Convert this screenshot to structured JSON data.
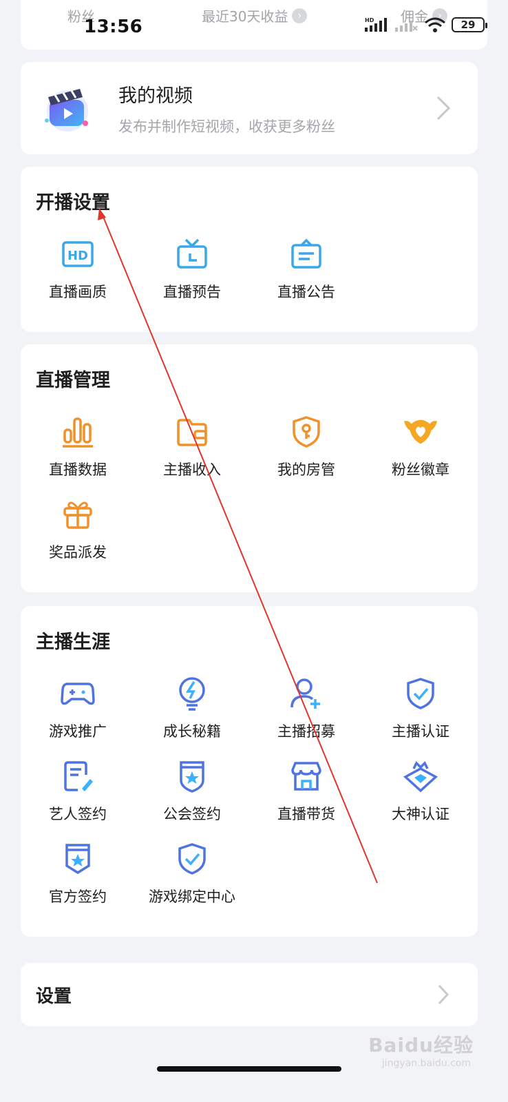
{
  "status_bar": {
    "time": "13:56",
    "battery": "29",
    "network_label": "HD"
  },
  "top_stats": {
    "fans_label": "粉丝",
    "earnings_label": "最近30天收益",
    "commission_label": "佣金"
  },
  "video_card": {
    "title": "我的视频",
    "subtitle": "发布并制作短视频，收获更多粉丝",
    "icon": "video-clapper-icon"
  },
  "sections": [
    {
      "title": "开播设置",
      "items": [
        {
          "label": "直播画质",
          "icon": "hd-icon",
          "color": "#3aa7e8"
        },
        {
          "label": "直播预告",
          "icon": "tv-icon",
          "color": "#3aa7e8"
        },
        {
          "label": "直播公告",
          "icon": "notice-board-icon",
          "color": "#3aa7e8"
        }
      ]
    },
    {
      "title": "直播管理",
      "items": [
        {
          "label": "直播数据",
          "icon": "bar-chart-icon",
          "color": "#f0922c"
        },
        {
          "label": "主播收入",
          "icon": "wallet-icon",
          "color": "#f0922c"
        },
        {
          "label": "我的房管",
          "icon": "shield-key-icon",
          "color": "#f0922c"
        },
        {
          "label": "粉丝徽章",
          "icon": "heart-badge-icon",
          "color": "#f0a020"
        },
        {
          "label": "奖品派发",
          "icon": "gift-icon",
          "color": "#f0922c"
        }
      ]
    },
    {
      "title": "主播生涯",
      "items": [
        {
          "label": "游戏推广",
          "icon": "gamepad-icon",
          "color": "#4f73e0"
        },
        {
          "label": "成长秘籍",
          "icon": "bulb-icon",
          "color": "#4f73e0"
        },
        {
          "label": "主播招募",
          "icon": "add-user-icon",
          "color": "#4f73e0"
        },
        {
          "label": "主播认证",
          "icon": "shield-check-icon",
          "color": "#4f73e0"
        },
        {
          "label": "艺人签约",
          "icon": "doc-pen-icon",
          "color": "#4f73e0"
        },
        {
          "label": "公会签约",
          "icon": "star-shield-icon",
          "color": "#4f73e0"
        },
        {
          "label": "直播带货",
          "icon": "shop-icon",
          "color": "#4f73e0"
        },
        {
          "label": "大神认证",
          "icon": "crown-diamond-icon",
          "color": "#4f73e0"
        },
        {
          "label": "官方签约",
          "icon": "star-badge-icon",
          "color": "#4f73e0"
        },
        {
          "label": "游戏绑定中心",
          "icon": "shield-check-icon",
          "color": "#4f73e0"
        }
      ]
    }
  ],
  "settings": {
    "label": "设置"
  },
  "watermark": {
    "brand": "Baidu经验",
    "url": "jingyan.baidu.com"
  },
  "colors": {
    "annotation_arrow": "#e0352b"
  }
}
